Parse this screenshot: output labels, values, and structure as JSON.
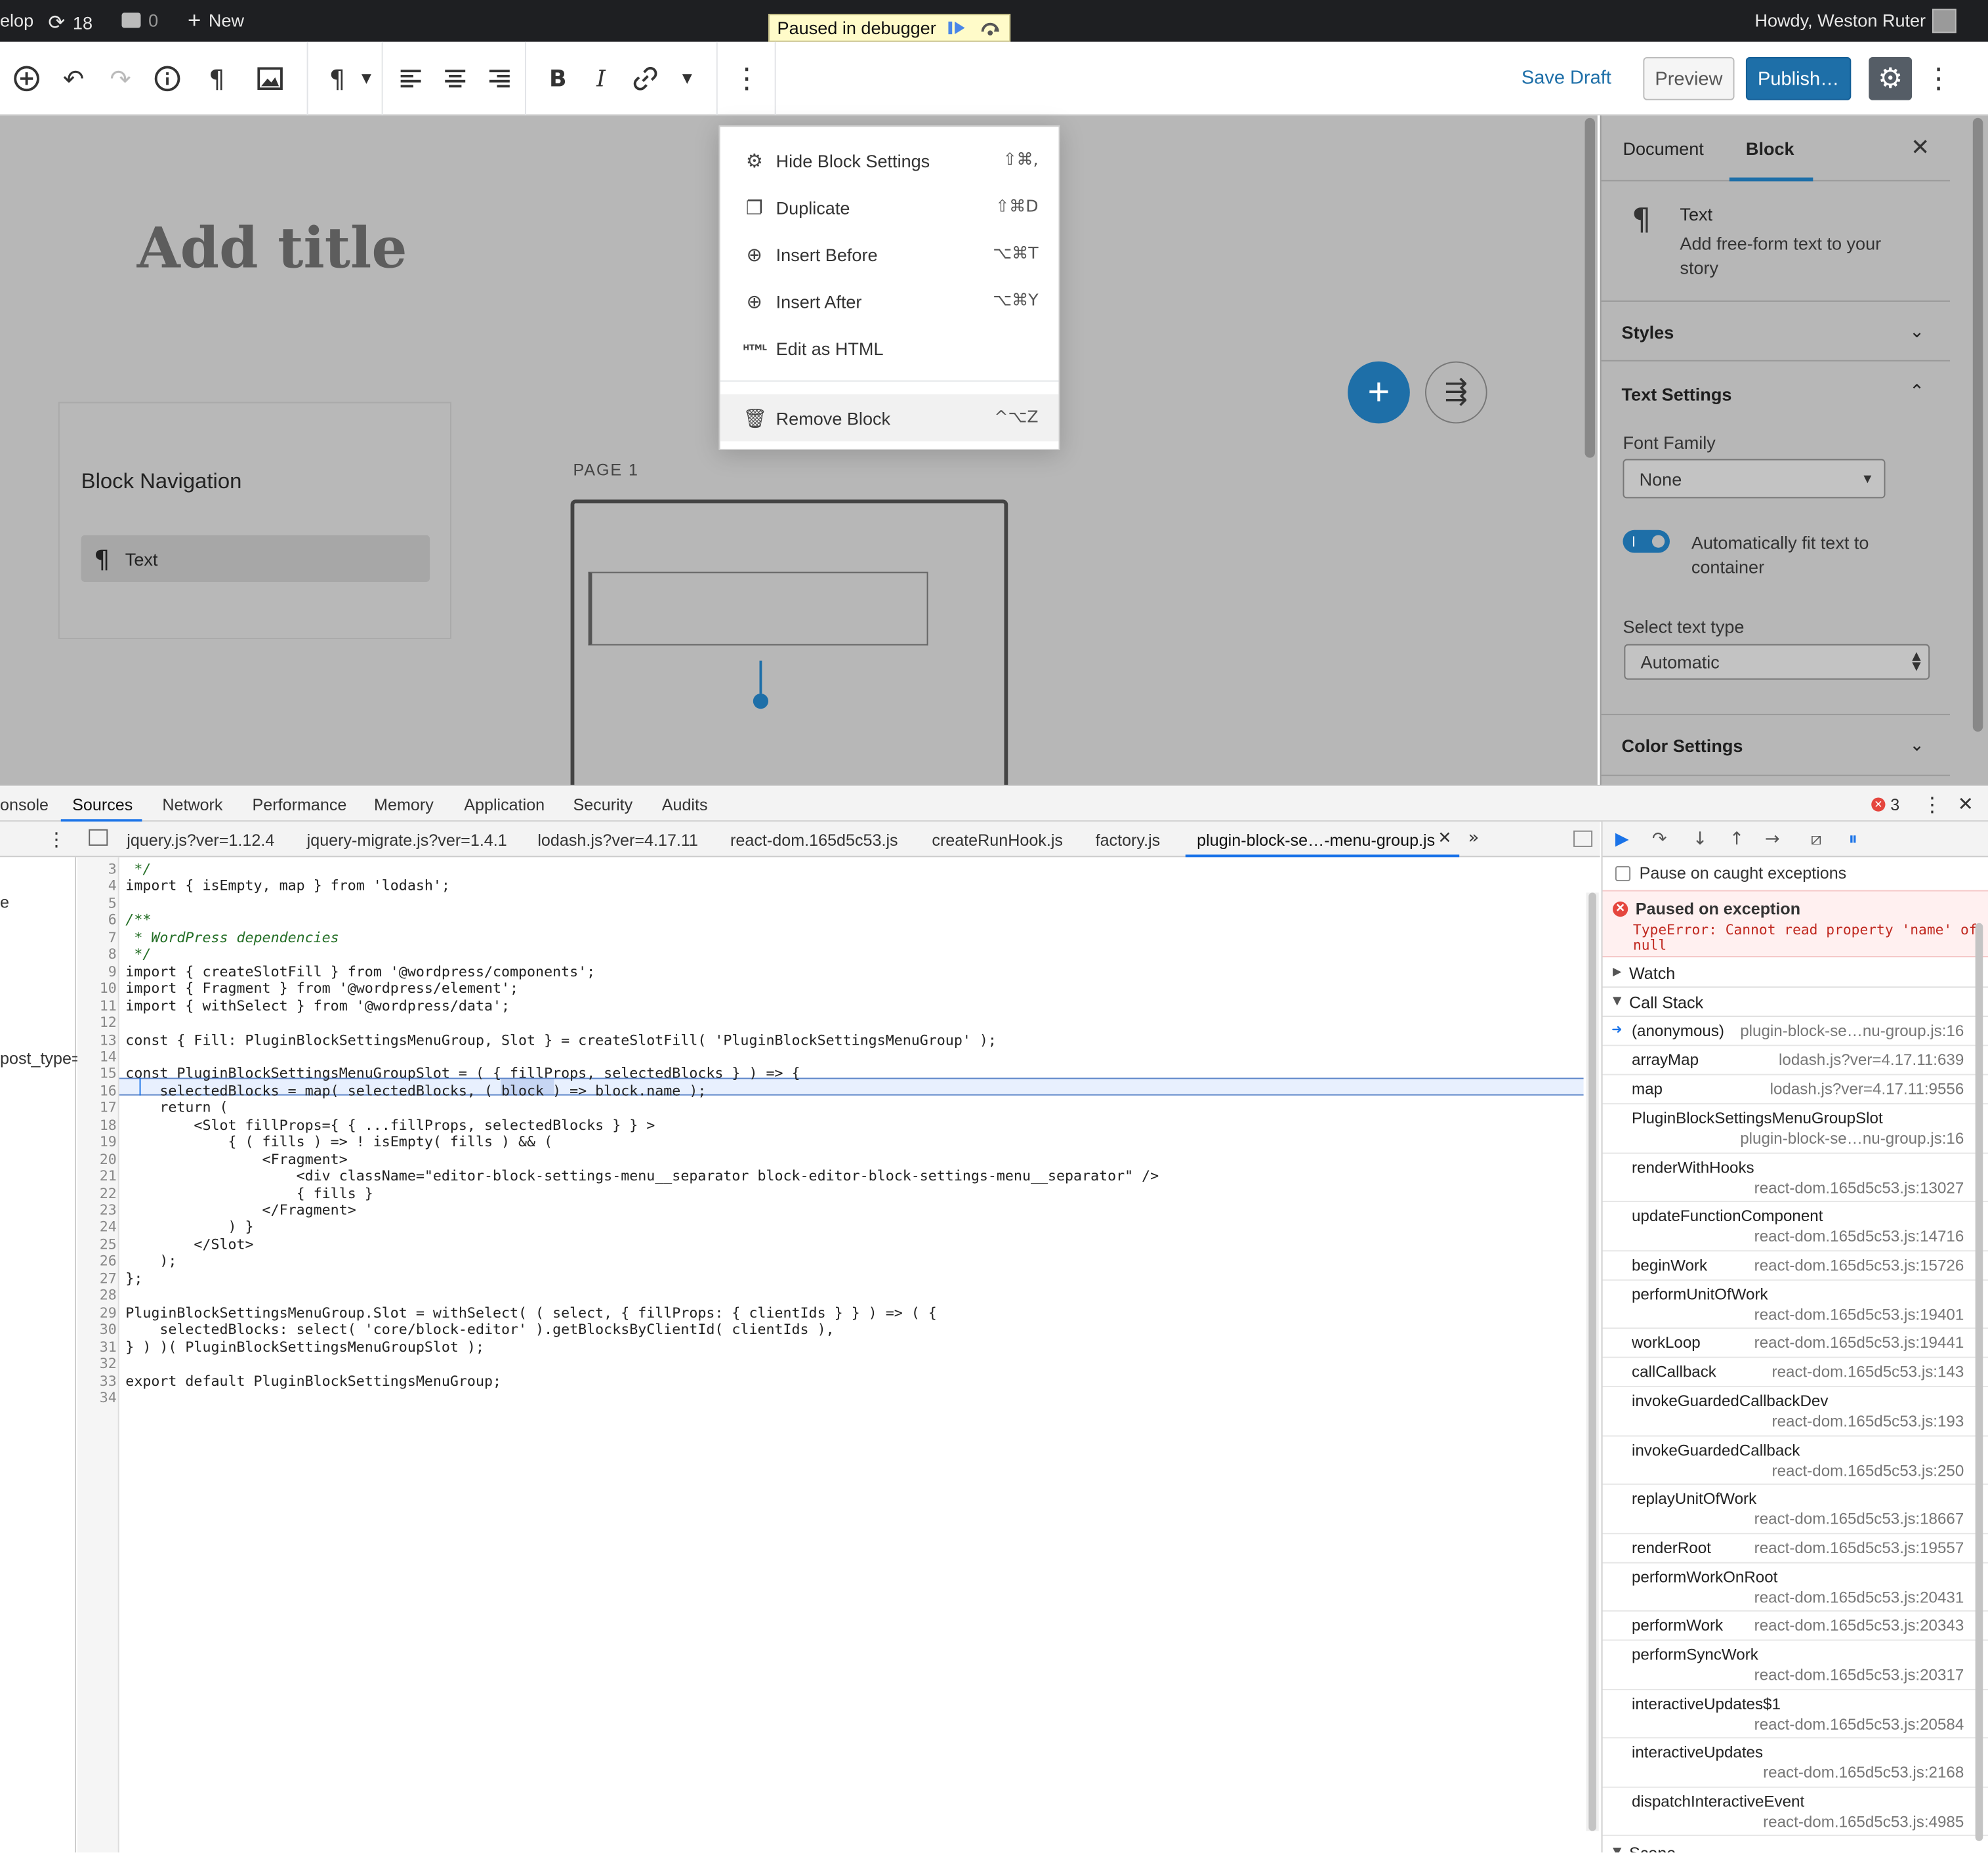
{
  "admin_bar": {
    "site_fragment": "elop",
    "updates_count": "18",
    "comments_count": "0",
    "new_label": "New",
    "paused_label": "Paused in debugger",
    "greeting": "Howdy, Weston Ruter"
  },
  "toolbar": {
    "save_draft": "Save Draft",
    "preview": "Preview",
    "publish": "Publish…"
  },
  "editor": {
    "title_placeholder": "Add title",
    "block_navigation": {
      "title": "Block Navigation",
      "item": "Text"
    },
    "page_label": "PAGE 1"
  },
  "block_menu": {
    "items": [
      {
        "label": "Hide Block Settings",
        "shortcut": "⇧⌘,",
        "icon": "gear-icon"
      },
      {
        "label": "Duplicate",
        "shortcut": "⇧⌘D",
        "icon": "duplicate-icon"
      },
      {
        "label": "Insert Before",
        "shortcut": "⌥⌘T",
        "icon": "insert-before-icon"
      },
      {
        "label": "Insert After",
        "shortcut": "⌥⌘Y",
        "icon": "insert-after-icon"
      },
      {
        "label": "Edit as HTML",
        "shortcut": "",
        "icon": "html-icon"
      },
      {
        "label": "Remove Block",
        "shortcut": "^⌥Z",
        "icon": "trash-icon"
      }
    ],
    "html_icon_text": "HTML"
  },
  "sidebar": {
    "tabs": [
      "Document",
      "Block"
    ],
    "block_card": {
      "name": "Text",
      "description": "Add free-form text to your story"
    },
    "panels": {
      "styles": "Styles",
      "text_settings": "Text Settings",
      "color_settings": "Color Settings"
    },
    "font_family_label": "Font Family",
    "font_family_value": "None",
    "autofit_label": "Automatically fit text to container",
    "autofit_on": true,
    "text_type_label": "Select text type",
    "text_type_value": "Automatic"
  },
  "devtools": {
    "tabs": [
      "onsole",
      "Sources",
      "Network",
      "Performance",
      "Memory",
      "Application",
      "Security",
      "Audits"
    ],
    "error_count": "3",
    "file_tabs": [
      "jquery.js?ver=1.12.4",
      "jquery-migrate.js?ver=1.4.1",
      "lodash.js?ver=4.17.11",
      "react-dom.165d5c53.js",
      "createRunHook.js",
      "factory.js",
      "plugin-block-se…-menu-group.js"
    ],
    "nav_fragments": [
      "e",
      "post_type="
    ],
    "code": {
      "line_numbers": [
        "3",
        "4",
        "5",
        "6",
        "7",
        "8",
        "9",
        "10",
        "11",
        "12",
        "13",
        "14",
        "15",
        "16",
        "17",
        "18",
        "19",
        "20",
        "21",
        "22",
        "23",
        "24",
        "25",
        "26",
        "27",
        "28",
        "29",
        "30",
        "31",
        "32",
        "33",
        "34"
      ],
      "lines": [
        " */",
        "import { isEmpty, map } from 'lodash';",
        "",
        "/**",
        " * WordPress dependencies",
        " */",
        "import { createSlotFill } from '@wordpress/components';",
        "import { Fragment } from '@wordpress/element';",
        "import { withSelect } from '@wordpress/data';",
        "",
        "const { Fill: PluginBlockSettingsMenuGroup, Slot } = createSlotFill( 'PluginBlockSettingsMenuGroup' );",
        "",
        "const PluginBlockSettingsMenuGroupSlot = ( { fillProps, selectedBlocks } ) => {",
        "    selectedBlocks = map( selectedBlocks, ( block ) => block.name );",
        "    return (",
        "        <Slot fillProps={ { ...fillProps, selectedBlocks } } >",
        "            { ( fills ) => ! isEmpty( fills ) && (",
        "                <Fragment>",
        "                    <div className=\"editor-block-settings-menu__separator block-editor-block-settings-menu__separator\" />",
        "                    { fills }",
        "                </Fragment>",
        "            ) }",
        "        </Slot>",
        "    );",
        "};",
        "",
        "PluginBlockSettingsMenuGroup.Slot = withSelect( ( select, { fillProps: { clientIds } } ) => ( {",
        "    selectedBlocks: select( 'core/block-editor' ).getBlocksByClientId( clientIds ),",
        "} ) )( PluginBlockSettingsMenuGroupSlot );",
        "",
        "export default PluginBlockSettingsMenuGroup;",
        ""
      ]
    },
    "debugger": {
      "pause_on_caught": "Pause on caught exceptions",
      "paused_title": "Paused on exception",
      "paused_message": "TypeError: Cannot read property 'name' of null",
      "watch": "Watch",
      "call_stack": "Call Stack",
      "scope": "Scope",
      "frames": [
        {
          "name": "(anonymous)",
          "loc": "plugin-block-se…nu-group.js:16",
          "two_line": false
        },
        {
          "name": "arrayMap",
          "loc": "lodash.js?ver=4.17.11:639",
          "two_line": false
        },
        {
          "name": "map",
          "loc": "lodash.js?ver=4.17.11:9556",
          "two_line": false
        },
        {
          "name": "PluginBlockSettingsMenuGroupSlot",
          "loc": "plugin-block-se…nu-group.js:16",
          "two_line": true
        },
        {
          "name": "renderWithHooks",
          "loc": "react-dom.165d5c53.js:13027",
          "two_line": true
        },
        {
          "name": "updateFunctionComponent",
          "loc": "react-dom.165d5c53.js:14716",
          "two_line": true
        },
        {
          "name": "beginWork",
          "loc": "react-dom.165d5c53.js:15726",
          "two_line": false
        },
        {
          "name": "performUnitOfWork",
          "loc": "react-dom.165d5c53.js:19401",
          "two_line": true
        },
        {
          "name": "workLoop",
          "loc": "react-dom.165d5c53.js:19441",
          "two_line": false
        },
        {
          "name": "callCallback",
          "loc": "react-dom.165d5c53.js:143",
          "two_line": false
        },
        {
          "name": "invokeGuardedCallbackDev",
          "loc": "react-dom.165d5c53.js:193",
          "two_line": true
        },
        {
          "name": "invokeGuardedCallback",
          "loc": "react-dom.165d5c53.js:250",
          "two_line": true
        },
        {
          "name": "replayUnitOfWork",
          "loc": "react-dom.165d5c53.js:18667",
          "two_line": true
        },
        {
          "name": "renderRoot",
          "loc": "react-dom.165d5c53.js:19557",
          "two_line": false
        },
        {
          "name": "performWorkOnRoot",
          "loc": "react-dom.165d5c53.js:20431",
          "two_line": true
        },
        {
          "name": "performWork",
          "loc": "react-dom.165d5c53.js:20343",
          "two_line": false
        },
        {
          "name": "performSyncWork",
          "loc": "react-dom.165d5c53.js:20317",
          "two_line": true
        },
        {
          "name": "interactiveUpdates$1",
          "loc": "react-dom.165d5c53.js:20584",
          "two_line": true
        },
        {
          "name": "interactiveUpdates",
          "loc": "react-dom.165d5c53.js:2168",
          "two_line": true
        },
        {
          "name": "dispatchInteractiveEvent",
          "loc": "react-dom.165d5c53.js:4985",
          "two_line": true
        }
      ]
    }
  },
  "colors": {
    "accent": "#1e6fa8",
    "admin_bar_bg": "#1e1f22",
    "editor_overlay": "#b7b7b7",
    "error": "#c0281f",
    "devtools_blue": "#1a73e8"
  }
}
